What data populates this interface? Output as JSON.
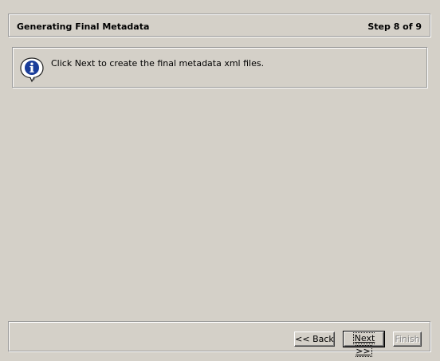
{
  "wizard": {
    "title": "Generating Final Metadata",
    "step_indicator": "Step 8 of 9"
  },
  "info": {
    "icon": "info-speech-bubble-icon",
    "message": "Click Next to create the final metadata xml files."
  },
  "buttons": {
    "back_label": "<< Back",
    "next_label": "Next >>",
    "finish_label": "Finish"
  },
  "colors": {
    "background": "#d4d0c8",
    "info_icon_blue": "#1a3d9a"
  }
}
